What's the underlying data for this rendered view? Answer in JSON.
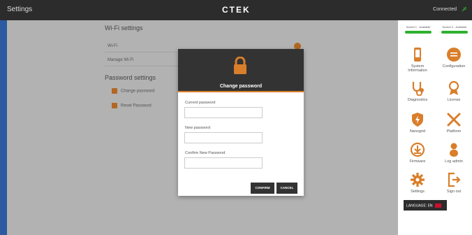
{
  "header": {
    "title": "Settings",
    "logo": "CTEK",
    "connection_status": "Connected"
  },
  "main": {
    "wifi_title": "Wi-Fi settings",
    "wifi_rows": [
      "Wi-Fi",
      "Manage Wi-Fi"
    ],
    "password_title": "Password settings",
    "password_rows": [
      "Change password",
      "Reset Password"
    ]
  },
  "sidebar": {
    "badges": [
      "Socket 1 - Available",
      "Socket 2 - Available"
    ],
    "items": [
      {
        "label": "System\nInformation",
        "icon": "phone-icon"
      },
      {
        "label": "Configuration",
        "icon": "configuration-icon"
      },
      {
        "label": "Diagnostics",
        "icon": "stethoscope-icon"
      },
      {
        "label": "License",
        "icon": "ribbon-icon"
      },
      {
        "label": "Nanogrid",
        "icon": "shield-bolt-icon"
      },
      {
        "label": "Platform",
        "icon": "tools-icon"
      },
      {
        "label": "Firmware",
        "icon": "firmware-icon"
      },
      {
        "label": "Log admin",
        "icon": "person-icon"
      },
      {
        "label": "Settings",
        "icon": "gear-icon"
      },
      {
        "label": "Sign out",
        "icon": "sign-out-icon"
      }
    ],
    "language": "LANGUAGE: EN"
  },
  "modal": {
    "title": "Change password",
    "fields": [
      {
        "label": "Current password",
        "value": ""
      },
      {
        "label": "New password",
        "value": ""
      },
      {
        "label": "Confirm New Password",
        "value": ""
      }
    ],
    "confirm_label": "CONFIRM",
    "cancel_label": "CANCEL"
  },
  "colors": {
    "accent": "#d97e2a",
    "status_green": "#2fb12f",
    "topbar": "#2c2c2c"
  }
}
